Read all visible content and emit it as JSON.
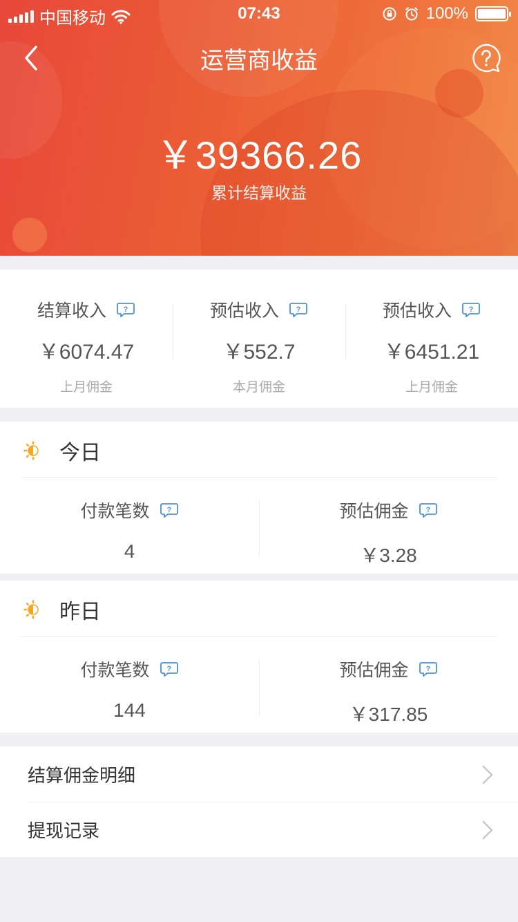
{
  "status_bar": {
    "carrier": "中国移动",
    "time": "07:43",
    "battery": "100%"
  },
  "nav": {
    "title": "运营商收益",
    "back_icon": "chevron-left-icon",
    "help_icon": "question-bubble-icon"
  },
  "summary_top": {
    "total_amount": "￥39366.26",
    "total_label": "累计结算收益"
  },
  "income": [
    {
      "label": "结算收入",
      "value": "￥6074.47",
      "sub": "上月佣金"
    },
    {
      "label": "预估收入",
      "value": "￥552.7",
      "sub": "本月佣金"
    },
    {
      "label": "预估收入",
      "value": "￥6451.21",
      "sub": "上月佣金"
    }
  ],
  "today": {
    "title": "今日",
    "payment_label": "付款笔数",
    "payment_value": "4",
    "commission_label": "预估佣金",
    "commission_value": "￥3.28"
  },
  "yesterday": {
    "title": "昨日",
    "payment_label": "付款笔数",
    "payment_value": "144",
    "commission_label": "预估佣金",
    "commission_value": "￥317.85"
  },
  "menu": [
    {
      "label": "结算佣金明细"
    },
    {
      "label": "提现记录"
    }
  ],
  "colors": {
    "header_start": "#e8483a",
    "header_end": "#f18a4a",
    "info_icon": "#4a90e2",
    "sun_icon": "#f5a623",
    "background": "#efeff4"
  }
}
